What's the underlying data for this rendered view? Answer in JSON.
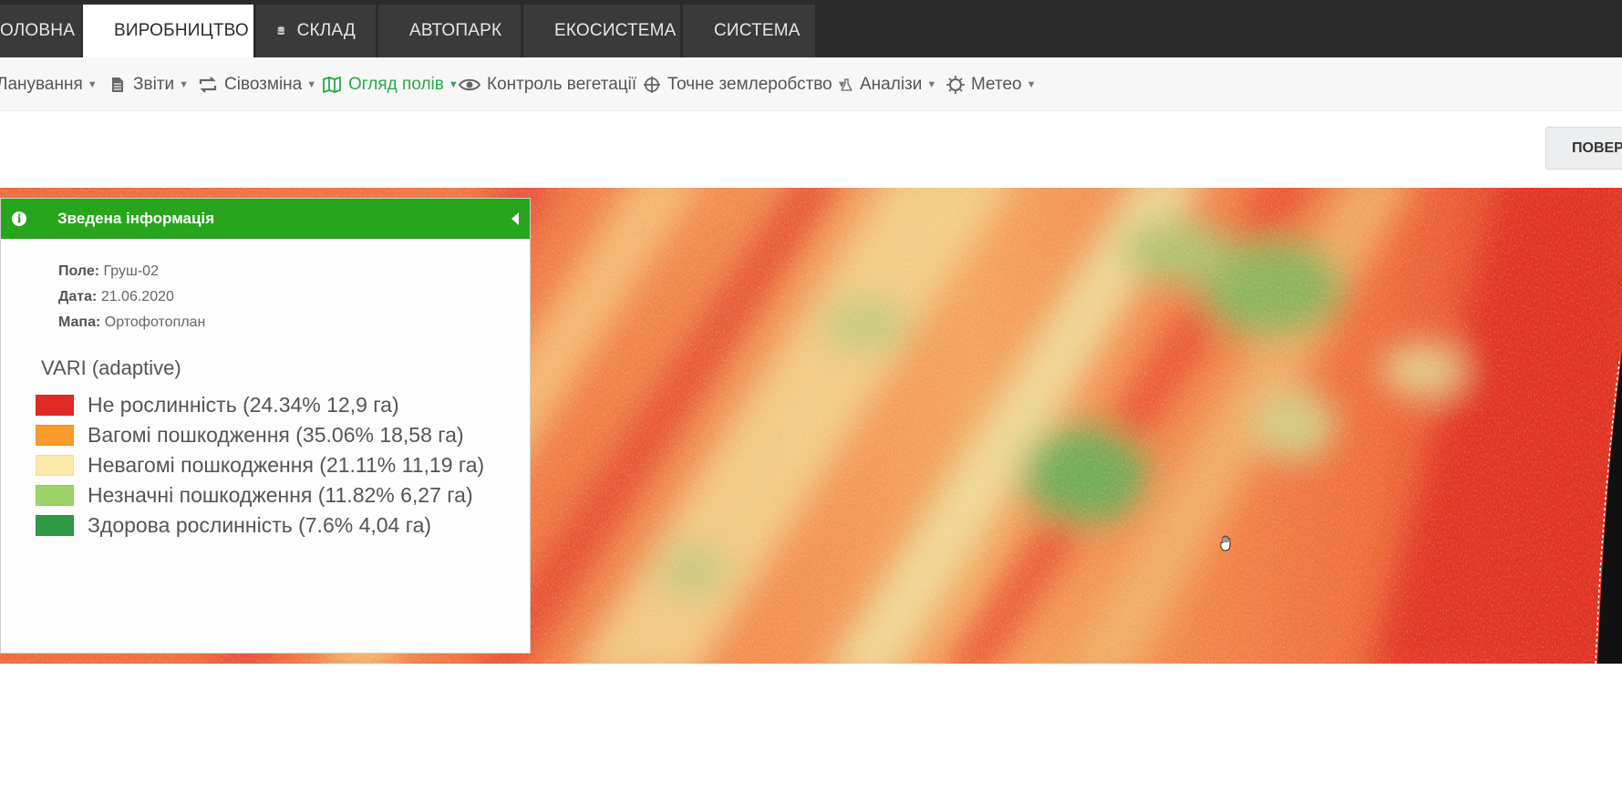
{
  "topnav": {
    "tabs": [
      {
        "label": "ГОЛОВНА",
        "icon": "home-icon"
      },
      {
        "label": "ВИРОБНИЦТВО",
        "icon": "leaf-icon"
      },
      {
        "label": "СКЛАД",
        "icon": "database-icon"
      },
      {
        "label": "АВТОПАРК",
        "icon": "truck-icon"
      },
      {
        "label": "ЕКОСИСТЕМА",
        "icon": "chat-icon"
      },
      {
        "label": "СИСТЕМА",
        "icon": "lock-icon"
      }
    ],
    "visible_first_label": "ОЛОВНА",
    "active_tab": "ВИРОБНИЦТВО"
  },
  "submenu": {
    "items": [
      {
        "label": "Планування",
        "visible_label": "Ланування"
      },
      {
        "label": "Звіти",
        "icon": "document-icon"
      },
      {
        "label": "Сівозміна",
        "icon": "rotate-icon"
      },
      {
        "label": "Огляд полів",
        "icon": "map-icon"
      },
      {
        "label": "Контроль вегетації",
        "icon": "eye-icon"
      },
      {
        "label": "Точне землеробство",
        "icon": "crosshair-icon"
      },
      {
        "label": "Аналізи",
        "icon": "flask-icon"
      },
      {
        "label": "Метео",
        "icon": "sun-icon"
      }
    ],
    "active_item": "Огляд полів"
  },
  "right_button": {
    "label": "ПОВЕРН"
  },
  "panel": {
    "title": "Зведена інформація",
    "field_label": "Поле:",
    "field_value": "Груш-02",
    "date_label": "Дата:",
    "date_value": "21.06.2020",
    "map_label": "Мапа:",
    "map_value": "Ортофотоплан",
    "legend_title": "VARI (adaptive)",
    "legend": [
      {
        "text": "Не рослинність (24.34% 12,9 га)",
        "color": "#e02a24"
      },
      {
        "text": "Вагомі пошкодження (35.06% 18,58 га)",
        "color": "#f99b2c"
      },
      {
        "text": "Невагомі пошкодження (21.11% 11,19 га)",
        "color": "#fce9a8"
      },
      {
        "text": "Незначні пошкодження (11.82% 6,27 га)",
        "color": "#9cd46a"
      },
      {
        "text": "Здорова рослинність (7.6% 4,04 га)",
        "color": "#2e9a46"
      }
    ]
  },
  "colors": {
    "accent_green": "#27a51c",
    "active_link": "#2aa84a",
    "topbar": "#2b2b2b"
  }
}
